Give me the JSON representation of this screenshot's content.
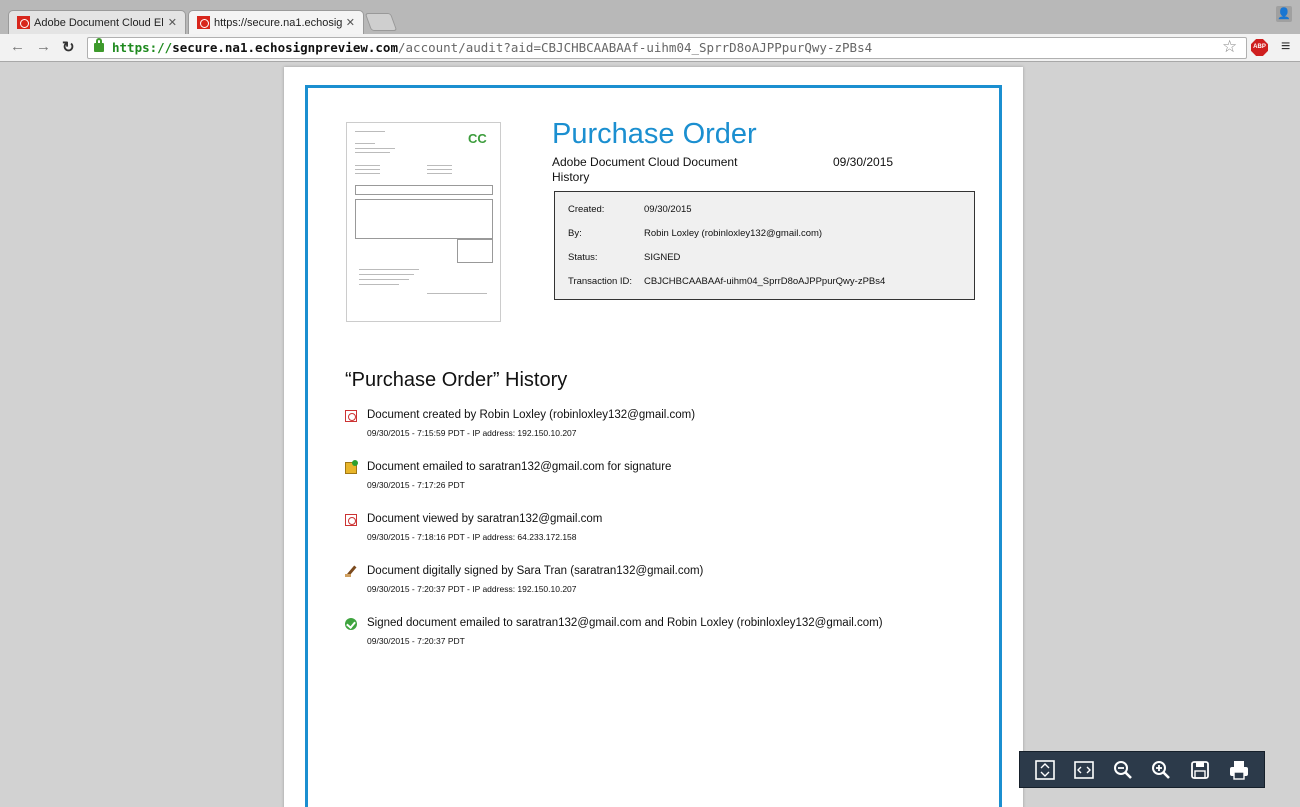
{
  "browser": {
    "tabs": [
      {
        "title": "Adobe Document Cloud Ele",
        "active": false
      },
      {
        "title": "https://secure.na1.echosig",
        "active": true
      }
    ],
    "url": {
      "scheme": "https://",
      "host": "secure.na1.echosignpreview.com",
      "path": "/account/audit?aid=CBJCHBCAABAAf-uihm04_SprrD8oAJPPpurQwy-zPBs4"
    },
    "adblock_label": "ABP"
  },
  "document": {
    "title": "Purchase Order",
    "subtitle": "Adobe Document Cloud Document History",
    "date": "09/30/2015",
    "thumbnail_logo": "CC",
    "info": [
      {
        "label": "Created:",
        "value": "09/30/2015"
      },
      {
        "label": "By:",
        "value": "Robin Loxley (robinloxley132@gmail.com)"
      },
      {
        "label": "Status:",
        "value": "SIGNED"
      },
      {
        "label": "Transaction ID:",
        "value": "CBJCHBCAABAAf-uihm04_SprrD8oAJPPpurQwy-zPBs4"
      }
    ],
    "history_title": "“Purchase Order” History",
    "events": [
      {
        "icon": "pdf-icon",
        "text": "Document created by Robin Loxley (robinloxley132@gmail.com)",
        "meta": "09/30/2015 - 7:15:59 PDT - IP address: 192.150.10.207"
      },
      {
        "icon": "email-icon",
        "text": "Document emailed to saratran132@gmail.com for signature",
        "meta": "09/30/2015 - 7:17:26 PDT"
      },
      {
        "icon": "pdf-icon",
        "text": "Document viewed by saratran132@gmail.com",
        "meta": "09/30/2015 - 7:18:16 PDT - IP address: 64.233.172.158"
      },
      {
        "icon": "signature-pen-icon",
        "text": "Document digitally signed by Sara Tran (saratran132@gmail.com)",
        "meta": "09/30/2015 - 7:20:37 PDT - IP address: 192.150.10.207"
      },
      {
        "icon": "check-circle-icon",
        "text": "Signed document emailed to saratran132@gmail.com and Robin Loxley (robinloxley132@gmail.com)",
        "meta": "09/30/2015 - 7:20:37 PDT"
      }
    ]
  },
  "pdf_toolbar": [
    "fit-page-icon",
    "fit-width-icon",
    "zoom-out-icon",
    "zoom-in-icon",
    "save-icon",
    "print-icon"
  ]
}
